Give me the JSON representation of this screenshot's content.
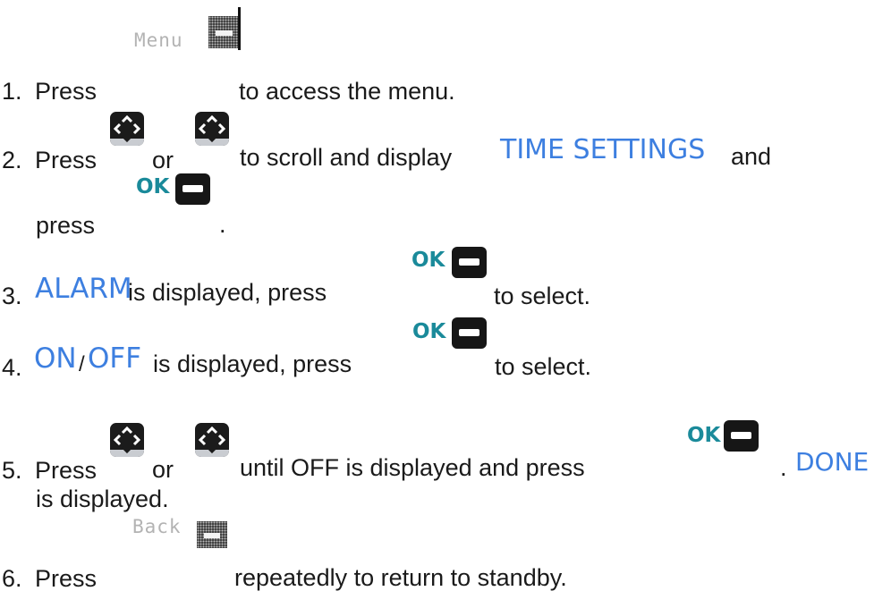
{
  "steps": [
    {
      "num": "1.",
      "press": "Press",
      "key_label": "Menu",
      "after": "to access the menu."
    },
    {
      "num": "2.",
      "press": "Press",
      "or": "or",
      "mid": "to scroll and display",
      "highlight": "TIME SETTINGS",
      "tail": "and",
      "line2": "press",
      "ok_label": "OK",
      "dot": "."
    },
    {
      "num": "3.",
      "highlight": "ALARM",
      "mid": "is displayed, press",
      "ok_label": "OK",
      "after": "to select."
    },
    {
      "num": "4.",
      "highlight_on": "ON",
      "slash": "/",
      "highlight_off": "OFF",
      "mid": "is displayed, press",
      "ok_label": "OK",
      "after": "to select."
    },
    {
      "num": "5.",
      "press": "Press",
      "or": "or",
      "mid": "until OFF is displayed and press",
      "ok_label": "OK",
      "dot": ".",
      "highlight": "DONE",
      "line2": "is displayed."
    },
    {
      "num": "6.",
      "press": "Press",
      "key_label": "Back",
      "after": "repeatedly to return to standby."
    }
  ],
  "icons": {
    "nav_key": "nav-key-icon",
    "ok_key": "ok-key-icon",
    "menu_key": "menu-softkey-icon",
    "back_key": "back-softkey-icon"
  },
  "colors": {
    "highlight": "#3d7fe0",
    "ok_label": "#1a8a9a",
    "text": "#1a1a1a"
  }
}
